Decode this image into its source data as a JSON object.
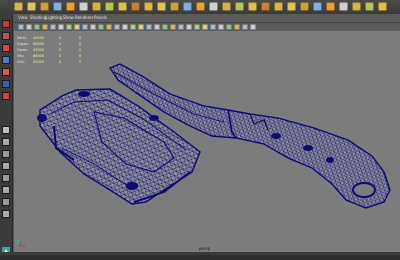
{
  "colors": {
    "viewport_bg": "#7c7c7c",
    "wire": "#0d0a74",
    "hud_label": "#d9e9f2",
    "hud_value": "#f0f0ab"
  },
  "shelf": {
    "icons": [
      "select-icon",
      "lasso-icon",
      "paint-icon",
      "move-icon",
      "rotate-icon",
      "scale-icon",
      "sphere-icon",
      "cube-icon",
      "cylinder-icon",
      "cone-icon",
      "plane-icon",
      "torus-icon",
      "camera-icon",
      "light-icon",
      "render-icon",
      "ipr-icon",
      "settings-icon",
      "snap-grid-icon",
      "snap-curve-icon",
      "snap-point-icon",
      "history-icon",
      "magnet-icon",
      "key-icon",
      "graph-icon",
      "outliner-icon",
      "hypershade-icon",
      "uv-icon",
      "script-icon",
      "help-icon"
    ]
  },
  "panel_menu": {
    "items": [
      "View",
      "Shading",
      "Lighting",
      "Show",
      "Renderer",
      "Panels"
    ]
  },
  "hud": {
    "rows": [
      {
        "label": "Verts:",
        "values": [
          "43000",
          "0",
          "0"
        ]
      },
      {
        "label": "Edges:",
        "values": [
          "86000",
          "0",
          "0"
        ]
      },
      {
        "label": "Faces:",
        "values": [
          "43000",
          "0",
          "0"
        ]
      },
      {
        "label": "Tris:",
        "values": [
          "86000",
          "0",
          "0"
        ]
      },
      {
        "label": "UVs:",
        "values": [
          "52000",
          "0",
          "0"
        ]
      }
    ]
  },
  "viewport": {
    "camera_label": "persp"
  }
}
